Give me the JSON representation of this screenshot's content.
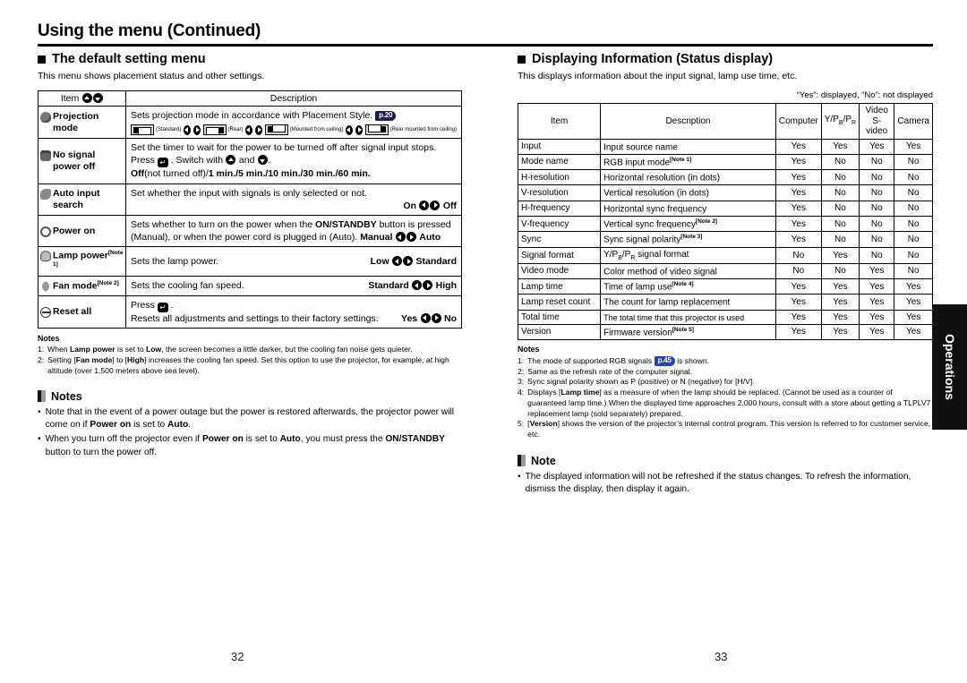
{
  "doc": {
    "title": "Using the menu (Continued)",
    "page_left": "32",
    "page_right": "33",
    "tab_label": "Operations"
  },
  "left": {
    "heading": "The default setting menu",
    "intro": "This menu shows placement status and other settings.",
    "table": {
      "header_item": "Item",
      "header_desc": "Description",
      "rows": [
        {
          "item": "Projection mode",
          "icon": "projection-icon",
          "desc_line1": "Sets projection mode in accordance with Placement Style.",
          "page_ref": "p.20",
          "modes": [
            {
              "label": "(Standard)"
            },
            {
              "label": "(Rear)"
            },
            {
              "label": "(Mounted from ceiling)"
            },
            {
              "label": "(Rear mounted from ceiling)"
            }
          ]
        },
        {
          "item": "No signal power off",
          "icon": "no-signal-icon",
          "desc_line1": "Set the timer to wait for the power to be turned off after signal input stops.",
          "desc_line2_a": "Press",
          "desc_line2_b": ". Switch with",
          "desc_line2_c": "and",
          "desc_line3_off": "Off",
          "desc_line3_rest": "(not turned off)/",
          "desc_line3_bold": "1 min./5 min./10 min./30 min./60 min."
        },
        {
          "item": "Auto input search",
          "icon": "auto-input-icon",
          "desc_line1": "Set whether the input with signals is only selected or not.",
          "opt_left": "On",
          "opt_right": "Off"
        },
        {
          "item": "Power on",
          "icon": "power-on-icon",
          "desc_a": "Sets whether to turn on the power when the",
          "desc_bold1": "ON/STANDBY",
          "desc_b": "button is pressed (Manual), or when the power cord is plugged in (Auto).",
          "opt_left": "Manual",
          "opt_right": "Auto"
        },
        {
          "item": "Lamp power",
          "icon": "lamp-power-icon",
          "note_ref": "[Note 1]",
          "desc_line1": "Sets the lamp power.",
          "opt_left": "Low",
          "opt_right": "Standard"
        },
        {
          "item": "Fan mode",
          "icon": "fan-mode-icon",
          "note_ref": "[Note 2]",
          "desc_line1": "Sets the cooling fan speed.",
          "opt_left": "Standard",
          "opt_right": "High"
        },
        {
          "item": "Reset all",
          "icon": "reset-all-icon",
          "desc_line1_a": "Press",
          "desc_line2": "Resets all adjustments and settings to their factory settings.",
          "opt_left": "Yes",
          "opt_right": "No"
        }
      ]
    },
    "notes": {
      "title": "Notes",
      "items": [
        {
          "num": "1:",
          "a": "When ",
          "b": "Lamp power",
          "c": " is set to ",
          "d": "Low",
          "e": ", the screen becomes a little darker, but the cooling fan noise gets quieter."
        },
        {
          "num": "2:",
          "a": "Setting [",
          "b": "Fan mode",
          "c": "] to [",
          "d": "High",
          "e": "] increases the cooling fan speed.  Set this option to use the projector, for example, at high altitude (over 1,500 meters above sea level)."
        }
      ]
    },
    "note_box": {
      "title": "Notes",
      "bullets": [
        {
          "a": "Note that in the event of a power outage but the power is restored afterwards, the projector power will come on if ",
          "b": "Power on",
          "c": " is set to ",
          "d": "Auto",
          "e": "."
        },
        {
          "a": "When you turn off the projector even if ",
          "b": "Power on",
          "c": " is set to ",
          "d": "Auto",
          "e": ", you must press the ",
          "f": "ON/STANDBY",
          "g": " button to turn the power off."
        }
      ]
    }
  },
  "right": {
    "heading": "Displaying Information (Status display)",
    "intro": "This displays information about the input signal, lamp use time, etc.",
    "legend": "“Yes”: displayed, “No”: not displayed",
    "table": {
      "headers": [
        "Item",
        "Description",
        "Computer",
        "Y/PB/PR",
        "Video S-video",
        "Camera"
      ],
      "header_computer": "Computer",
      "header_ypbpr": "Y/PB/PR",
      "header_video_l1": "Video",
      "header_video_l2": "S-video",
      "header_camera": "Camera",
      "rows": [
        {
          "item": "Input",
          "desc": "Input source name",
          "note": "",
          "computer": "Yes",
          "ypbpr": "Yes",
          "video": "Yes",
          "camera": "Yes"
        },
        {
          "item": "Mode name",
          "desc": "RGB input mode",
          "note": "[Note 1]",
          "computer": "Yes",
          "ypbpr": "No",
          "video": "No",
          "camera": "No"
        },
        {
          "item": "H-resolution",
          "desc": "Horizontal resolution (in dots)",
          "note": "",
          "computer": "Yes",
          "ypbpr": "No",
          "video": "No",
          "camera": "No"
        },
        {
          "item": "V-resolution",
          "desc": "Vertical resolution (in dots)",
          "note": "",
          "computer": "Yes",
          "ypbpr": "No",
          "video": "No",
          "camera": "No"
        },
        {
          "item": "H-frequency",
          "desc": "Horizontal sync frequency",
          "note": "",
          "computer": "Yes",
          "ypbpr": "No",
          "video": "No",
          "camera": "No"
        },
        {
          "item": "V-frequency",
          "desc": "Vertical sync frequency",
          "note": "[Note 2]",
          "computer": "Yes",
          "ypbpr": "No",
          "video": "No",
          "camera": "No"
        },
        {
          "item": "Sync",
          "desc": "Sync signal polarity",
          "note": "[Note 3]",
          "computer": "Yes",
          "ypbpr": "No",
          "video": "No",
          "camera": "No"
        },
        {
          "item": "Signal format",
          "desc": "Y/PB/PR signal format",
          "note": "",
          "computer": "No",
          "ypbpr": "Yes",
          "video": "No",
          "camera": "No"
        },
        {
          "item": "Video mode",
          "desc": "Color method of video signal",
          "note": "",
          "computer": "No",
          "ypbpr": "No",
          "video": "Yes",
          "camera": "No"
        },
        {
          "item": "Lamp time",
          "desc": "Time of lamp use",
          "note": "[Note 4]",
          "computer": "Yes",
          "ypbpr": "Yes",
          "video": "Yes",
          "camera": "Yes"
        },
        {
          "item": "Lamp reset count",
          "desc": "The count for lamp replacement",
          "note": "",
          "computer": "Yes",
          "ypbpr": "Yes",
          "video": "Yes",
          "camera": "Yes"
        },
        {
          "item": "Total time",
          "desc": "The total time that this projector is used",
          "note": "",
          "computer": "Yes",
          "ypbpr": "Yes",
          "video": "Yes",
          "camera": "Yes"
        },
        {
          "item": "Version",
          "desc": "Firmware version",
          "note": "[Note 5]",
          "computer": "Yes",
          "ypbpr": "Yes",
          "video": "Yes",
          "camera": "Yes"
        }
      ]
    },
    "notes": {
      "title": "Notes",
      "items": [
        {
          "num": "1:",
          "a": "The mode of supported RGB signals",
          "ref": "p.45",
          "b": "is shown."
        },
        {
          "num": "2:",
          "a": "Same as the refresh rate of the computer signal.",
          "ref": "",
          "b": ""
        },
        {
          "num": "3:",
          "a": "Sync signal polarity shown as P (positive) or N (negative) for [H/V].",
          "ref": "",
          "b": ""
        },
        {
          "num": "4:",
          "a": "Displays [",
          "bold": "Lamp time",
          "b": "] as a measure of when the lamp should be replaced. (Cannot be used as a counter of guaranteed lamp time.) When the displayed time approaches 2,000 hours, consult with a store about getting a TLPLV7 replacement lamp (sold separately) prepared.",
          "ref": "",
          "is_bold_style": true
        },
        {
          "num": "5:",
          "a": "[",
          "bold": "Version",
          "b": "] shows the version of the projector’s internal control program. This version is referred to for customer service, etc.",
          "ref": "",
          "is_bold_style": true
        }
      ]
    },
    "note_box": {
      "title": "Note",
      "bullets": [
        {
          "a": "The displayed information will not be refreshed if the status changes. To refresh the information, dismiss the display, then display it again."
        }
      ]
    }
  },
  "colors": {
    "page_ref_dark": "#1a1a4e",
    "page_ref_blue": "#2546a8",
    "tab_bg": "#111111",
    "rule": "#000000"
  }
}
